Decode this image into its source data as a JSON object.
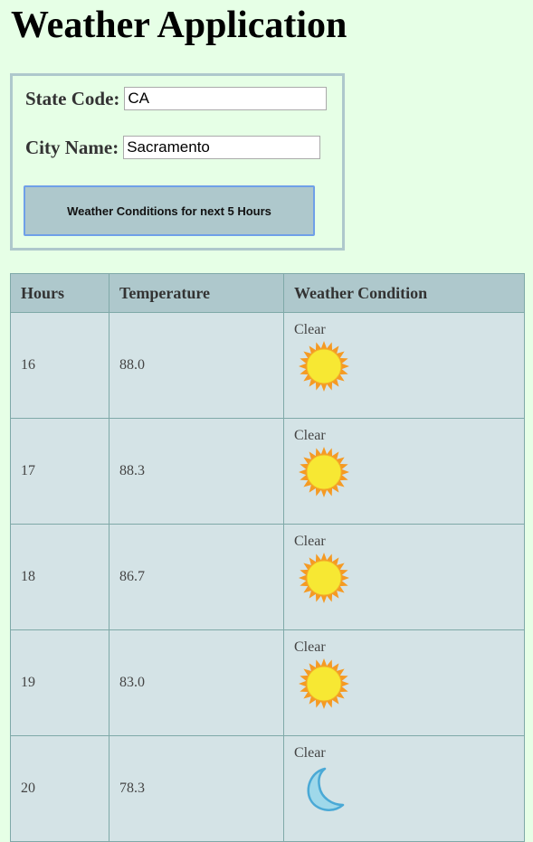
{
  "app": {
    "title": "Weather Application"
  },
  "form": {
    "state_label": "State Code:",
    "state_value": "CA",
    "city_label": "City Name:",
    "city_value": "Sacramento",
    "submit_label": "Weather Conditions for next 5 Hours"
  },
  "table": {
    "headers": [
      "Hours",
      "Temperature",
      "Weather Condition"
    ],
    "rows": [
      {
        "hour": "16",
        "temperature": "88.0",
        "condition": "Clear",
        "icon": "sun-icon"
      },
      {
        "hour": "17",
        "temperature": "88.3",
        "condition": "Clear",
        "icon": "sun-icon"
      },
      {
        "hour": "18",
        "temperature": "86.7",
        "condition": "Clear",
        "icon": "sun-icon"
      },
      {
        "hour": "19",
        "temperature": "83.0",
        "condition": "Clear",
        "icon": "sun-icon"
      },
      {
        "hour": "20",
        "temperature": "78.3",
        "condition": "Clear",
        "icon": "moon-icon"
      }
    ]
  },
  "colors": {
    "page_background": "#e6ffe6",
    "accent": "#aec8cc",
    "table_cell": "#d4e3e6",
    "button_border": "#6fa0e8",
    "sun_fill": "#f7e833",
    "sun_rays": "#f59a23",
    "moon_fill": "#9fd8ea",
    "moon_stroke": "#4aa9d6"
  }
}
